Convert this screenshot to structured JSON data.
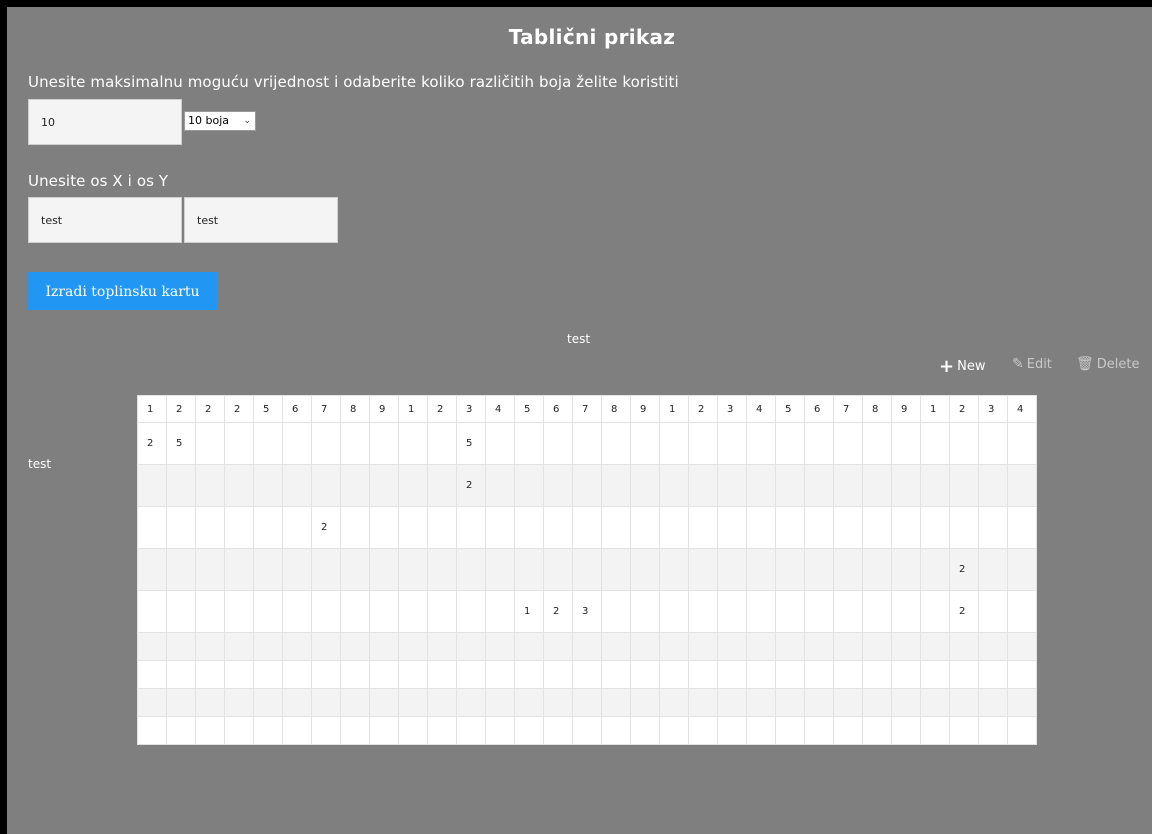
{
  "title": "Tablični prikaz",
  "max_section": {
    "label": "Unesite maksimalnu moguću vrijednost i odaberite koliko različitih boja želite koristiti",
    "max_value": "10",
    "color_count": "10 boja"
  },
  "axis_section": {
    "label": "Unesite os X i os Y",
    "x_value": "test",
    "y_value": "test"
  },
  "generate_label": "Izradi toplinsku kartu",
  "chart_title": "test",
  "toolbar": {
    "new_label": "New",
    "edit_label": "Edit",
    "delete_label": "Delete"
  },
  "y_axis_label": "test",
  "table": {
    "header": [
      "1",
      "2",
      "2",
      "2",
      "5",
      "6",
      "7",
      "8",
      "9",
      "1",
      "2",
      "3",
      "4",
      "5",
      "6",
      "7",
      "8",
      "9",
      "1",
      "2",
      "3",
      "4",
      "5",
      "6",
      "7",
      "8",
      "9",
      "1",
      "2",
      "3",
      "4"
    ],
    "rows": [
      {
        "cells": {
          "0": "2",
          "1": "5",
          "11": "5"
        }
      },
      {
        "cells": {
          "11": "2"
        }
      },
      {
        "cells": {
          "6": "2"
        }
      },
      {
        "cells": {
          "28": "2"
        }
      },
      {
        "cells": {
          "13": "1",
          "14": "2",
          "15": "3",
          "28": "2"
        }
      },
      {
        "cells": {}
      },
      {
        "cells": {}
      },
      {
        "cells": {}
      },
      {
        "cells": {}
      }
    ]
  },
  "colors": {
    "page_background": "#7f7f7f",
    "button_blue": "#2196f3",
    "row_shade": "#f3f3f3"
  }
}
